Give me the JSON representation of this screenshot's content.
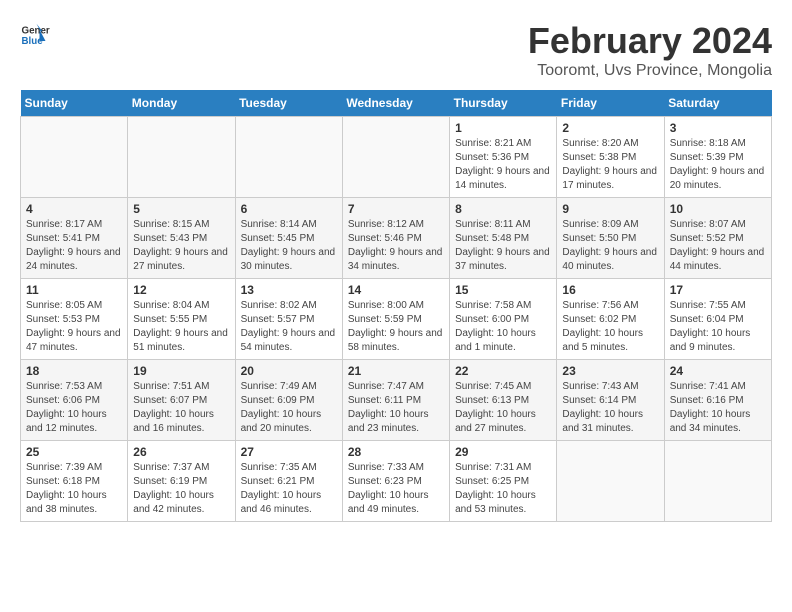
{
  "header": {
    "logo_general": "General",
    "logo_blue": "Blue",
    "title": "February 2024",
    "subtitle": "Tooromt, Uvs Province, Mongolia"
  },
  "calendar": {
    "days_of_week": [
      "Sunday",
      "Monday",
      "Tuesday",
      "Wednesday",
      "Thursday",
      "Friday",
      "Saturday"
    ],
    "weeks": [
      [
        {
          "day": "",
          "info": ""
        },
        {
          "day": "",
          "info": ""
        },
        {
          "day": "",
          "info": ""
        },
        {
          "day": "",
          "info": ""
        },
        {
          "day": "1",
          "info": "Sunrise: 8:21 AM\nSunset: 5:36 PM\nDaylight: 9 hours and 14 minutes."
        },
        {
          "day": "2",
          "info": "Sunrise: 8:20 AM\nSunset: 5:38 PM\nDaylight: 9 hours and 17 minutes."
        },
        {
          "day": "3",
          "info": "Sunrise: 8:18 AM\nSunset: 5:39 PM\nDaylight: 9 hours and 20 minutes."
        }
      ],
      [
        {
          "day": "4",
          "info": "Sunrise: 8:17 AM\nSunset: 5:41 PM\nDaylight: 9 hours and 24 minutes."
        },
        {
          "day": "5",
          "info": "Sunrise: 8:15 AM\nSunset: 5:43 PM\nDaylight: 9 hours and 27 minutes."
        },
        {
          "day": "6",
          "info": "Sunrise: 8:14 AM\nSunset: 5:45 PM\nDaylight: 9 hours and 30 minutes."
        },
        {
          "day": "7",
          "info": "Sunrise: 8:12 AM\nSunset: 5:46 PM\nDaylight: 9 hours and 34 minutes."
        },
        {
          "day": "8",
          "info": "Sunrise: 8:11 AM\nSunset: 5:48 PM\nDaylight: 9 hours and 37 minutes."
        },
        {
          "day": "9",
          "info": "Sunrise: 8:09 AM\nSunset: 5:50 PM\nDaylight: 9 hours and 40 minutes."
        },
        {
          "day": "10",
          "info": "Sunrise: 8:07 AM\nSunset: 5:52 PM\nDaylight: 9 hours and 44 minutes."
        }
      ],
      [
        {
          "day": "11",
          "info": "Sunrise: 8:05 AM\nSunset: 5:53 PM\nDaylight: 9 hours and 47 minutes."
        },
        {
          "day": "12",
          "info": "Sunrise: 8:04 AM\nSunset: 5:55 PM\nDaylight: 9 hours and 51 minutes."
        },
        {
          "day": "13",
          "info": "Sunrise: 8:02 AM\nSunset: 5:57 PM\nDaylight: 9 hours and 54 minutes."
        },
        {
          "day": "14",
          "info": "Sunrise: 8:00 AM\nSunset: 5:59 PM\nDaylight: 9 hours and 58 minutes."
        },
        {
          "day": "15",
          "info": "Sunrise: 7:58 AM\nSunset: 6:00 PM\nDaylight: 10 hours and 1 minute."
        },
        {
          "day": "16",
          "info": "Sunrise: 7:56 AM\nSunset: 6:02 PM\nDaylight: 10 hours and 5 minutes."
        },
        {
          "day": "17",
          "info": "Sunrise: 7:55 AM\nSunset: 6:04 PM\nDaylight: 10 hours and 9 minutes."
        }
      ],
      [
        {
          "day": "18",
          "info": "Sunrise: 7:53 AM\nSunset: 6:06 PM\nDaylight: 10 hours and 12 minutes."
        },
        {
          "day": "19",
          "info": "Sunrise: 7:51 AM\nSunset: 6:07 PM\nDaylight: 10 hours and 16 minutes."
        },
        {
          "day": "20",
          "info": "Sunrise: 7:49 AM\nSunset: 6:09 PM\nDaylight: 10 hours and 20 minutes."
        },
        {
          "day": "21",
          "info": "Sunrise: 7:47 AM\nSunset: 6:11 PM\nDaylight: 10 hours and 23 minutes."
        },
        {
          "day": "22",
          "info": "Sunrise: 7:45 AM\nSunset: 6:13 PM\nDaylight: 10 hours and 27 minutes."
        },
        {
          "day": "23",
          "info": "Sunrise: 7:43 AM\nSunset: 6:14 PM\nDaylight: 10 hours and 31 minutes."
        },
        {
          "day": "24",
          "info": "Sunrise: 7:41 AM\nSunset: 6:16 PM\nDaylight: 10 hours and 34 minutes."
        }
      ],
      [
        {
          "day": "25",
          "info": "Sunrise: 7:39 AM\nSunset: 6:18 PM\nDaylight: 10 hours and 38 minutes."
        },
        {
          "day": "26",
          "info": "Sunrise: 7:37 AM\nSunset: 6:19 PM\nDaylight: 10 hours and 42 minutes."
        },
        {
          "day": "27",
          "info": "Sunrise: 7:35 AM\nSunset: 6:21 PM\nDaylight: 10 hours and 46 minutes."
        },
        {
          "day": "28",
          "info": "Sunrise: 7:33 AM\nSunset: 6:23 PM\nDaylight: 10 hours and 49 minutes."
        },
        {
          "day": "29",
          "info": "Sunrise: 7:31 AM\nSunset: 6:25 PM\nDaylight: 10 hours and 53 minutes."
        },
        {
          "day": "",
          "info": ""
        },
        {
          "day": "",
          "info": ""
        }
      ]
    ]
  }
}
